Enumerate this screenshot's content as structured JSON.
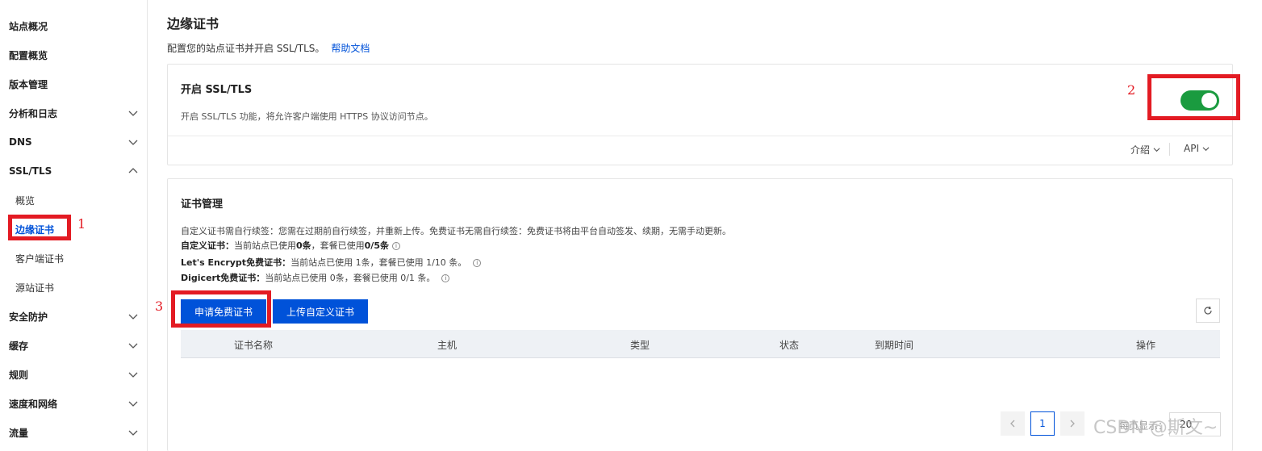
{
  "sidebar": {
    "items": [
      {
        "label": "站点概况"
      },
      {
        "label": "配置概览"
      },
      {
        "label": "版本管理"
      },
      {
        "label": "分析和日志"
      },
      {
        "label": "DNS"
      },
      {
        "label": "SSL/TLS"
      },
      {
        "label": "概览"
      },
      {
        "label": "边缘证书"
      },
      {
        "label": "客户端证书"
      },
      {
        "label": "源站证书"
      },
      {
        "label": "安全防护"
      },
      {
        "label": "缓存"
      },
      {
        "label": "规则"
      },
      {
        "label": "速度和网络"
      },
      {
        "label": "流量"
      }
    ],
    "active_label": "边缘证书"
  },
  "page": {
    "title": "边缘证书",
    "desc": "配置您的站点证书并开启 SSL/TLS。",
    "help_link": "帮助文档"
  },
  "ssl_card": {
    "title": "开启 SSL/TLS",
    "desc": "开启 SSL/TLS 功能，将允许客户端使用 HTTPS 协议访问节点。",
    "toggle_state": "on",
    "intro_label": "介绍",
    "api_label": "API"
  },
  "cert_card": {
    "title": "证书管理",
    "line1": "自定义证书需自行续签：您需在过期前自行续签，并重新上传。免费证书无需自行续签：免费证书将由平台自动签发、续期，无需手动更新。",
    "line2_key": "自定义证书：",
    "line2_pre": "当前站点已使用",
    "line2_used": "0条",
    "line2_mid": "，套餐已使用",
    "line2_quota": "0/5条",
    "line3_key": "Let's Encrypt免费证书：",
    "line3_val": "当前站点已使用 1条，套餐已使用 1/10 条。",
    "line4_key": "Digicert免费证书：",
    "line4_val": "当前站点已使用 0条，套餐已使用 0/1 条。",
    "btn_free": "申请免费证书",
    "btn_upload": "上传自定义证书",
    "columns": [
      "证书名称",
      "主机",
      "类型",
      "状态",
      "到期时间",
      "操作"
    ],
    "pagination": {
      "current_page": "1",
      "per_page_label": "每页显示：",
      "per_page_value": "20"
    }
  },
  "annotations": [
    "1",
    "2",
    "3"
  ],
  "watermark": "CSDN @斯文~",
  "colors": {
    "accent": "#0052d9",
    "toggle_on": "#1a9b3f",
    "annotation": "#e31b23"
  }
}
